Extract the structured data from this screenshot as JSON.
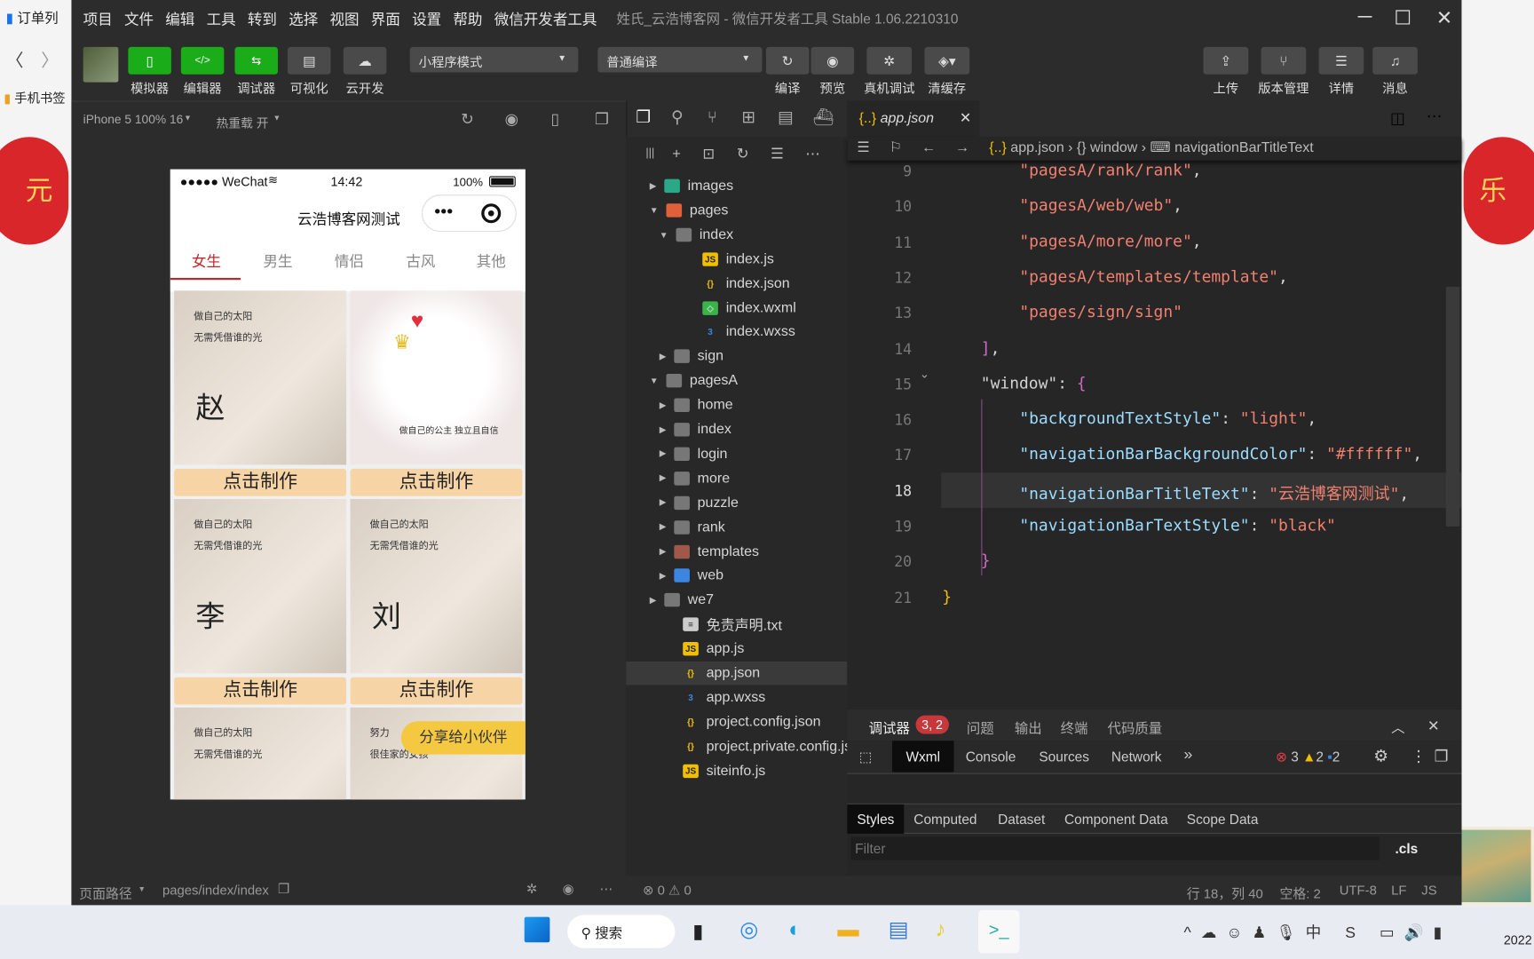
{
  "desktop": {
    "left_tab": "订单列",
    "left_bookmark": "手机书签",
    "right_lantern_left": "元",
    "right_lantern_right": "乐",
    "clock_year": "2022"
  },
  "window": {
    "menu": [
      "项目",
      "文件",
      "编辑",
      "工具",
      "转到",
      "选择",
      "视图",
      "界面",
      "设置",
      "帮助",
      "微信开发者工具"
    ],
    "title": "姓氏_云浩博客网 - 微信开发者工具 Stable 1.06.2210310",
    "toolbar_left": [
      {
        "label": "模拟器",
        "icon": "phone-icon",
        "active": true
      },
      {
        "label": "编辑器",
        "icon": "code-icon",
        "active": true
      },
      {
        "label": "调试器",
        "icon": "debug-icon",
        "active": true
      },
      {
        "label": "可视化",
        "icon": "layout-icon",
        "active": false
      },
      {
        "label": "云开发",
        "icon": "cloud-icon",
        "active": false
      }
    ],
    "mode_select": "小程序模式",
    "compile_select": "普通编译",
    "toolbar_mid": [
      {
        "label": "编译",
        "icon": "refresh-icon"
      },
      {
        "label": "预览",
        "icon": "eye-icon"
      },
      {
        "label": "真机调试",
        "icon": "bug-icon"
      },
      {
        "label": "清缓存",
        "icon": "layers-icon"
      }
    ],
    "toolbar_right": [
      {
        "label": "上传",
        "icon": "upload-icon"
      },
      {
        "label": "版本管理",
        "icon": "branch-icon"
      },
      {
        "label": "详情",
        "icon": "menu-icon"
      },
      {
        "label": "消息",
        "icon": "bell-icon"
      }
    ]
  },
  "simulator": {
    "device": "iPhone 5 100% 16",
    "hot_reload": "热重载 开",
    "phone": {
      "carrier": "●●●●● WeChat",
      "time": "14:42",
      "battery": "100%",
      "nav_title": "云浩博客网测试",
      "tabs": [
        "女生",
        "男生",
        "情侣",
        "古风",
        "其他"
      ],
      "active_tab": 0,
      "cards": [
        {
          "char": "赵",
          "line1": "做自己的太阳",
          "line2": "无需凭借谁的光",
          "button": "点击制作"
        },
        {
          "char": "",
          "line1": "",
          "line2": "做自己的公主 独立且自信",
          "button": "点击制作"
        },
        {
          "char": "李",
          "line1": "做自己的太阳",
          "line2": "无需凭借谁的光",
          "button": "点击制作"
        },
        {
          "char": "刘",
          "line1": "做自己的太阳",
          "line2": "无需凭借谁的光",
          "button": "点击制作"
        },
        {
          "char": "",
          "line1": "做自己的太阳",
          "line2": "无需凭借谁的光",
          "button": ""
        },
        {
          "char": "",
          "line1": "努力",
          "line2": "很佳家的女孩",
          "button": ""
        }
      ],
      "share_button": "分享给小伙伴"
    }
  },
  "filetree": [
    {
      "name": "images",
      "depth": 0,
      "type": "folder-img",
      "expanded": false
    },
    {
      "name": "pages",
      "depth": 0,
      "type": "folder-pages",
      "expanded": true
    },
    {
      "name": "index",
      "depth": 1,
      "type": "folder",
      "expanded": true
    },
    {
      "name": "index.js",
      "depth": 2,
      "type": "js"
    },
    {
      "name": "index.json",
      "depth": 2,
      "type": "json"
    },
    {
      "name": "index.wxml",
      "depth": 2,
      "type": "wxml"
    },
    {
      "name": "index.wxss",
      "depth": 2,
      "type": "wxss"
    },
    {
      "name": "sign",
      "depth": 1,
      "type": "folder",
      "expanded": false
    },
    {
      "name": "pagesA",
      "depth": 0,
      "type": "folder",
      "expanded": true
    },
    {
      "name": "home",
      "depth": 1,
      "type": "folder",
      "expanded": false
    },
    {
      "name": "index",
      "depth": 1,
      "type": "folder",
      "expanded": false
    },
    {
      "name": "login",
      "depth": 1,
      "type": "folder",
      "expanded": false
    },
    {
      "name": "more",
      "depth": 1,
      "type": "folder",
      "expanded": false
    },
    {
      "name": "puzzle",
      "depth": 1,
      "type": "folder",
      "expanded": false
    },
    {
      "name": "rank",
      "depth": 1,
      "type": "folder",
      "expanded": false
    },
    {
      "name": "templates",
      "depth": 1,
      "type": "folder-tpl",
      "expanded": false
    },
    {
      "name": "web",
      "depth": 1,
      "type": "folder-web",
      "expanded": false
    },
    {
      "name": "we7",
      "depth": 0,
      "type": "folder",
      "expanded": false
    },
    {
      "name": "免责声明.txt",
      "depth": 0,
      "type": "txt"
    },
    {
      "name": "app.js",
      "depth": 0,
      "type": "js"
    },
    {
      "name": "app.json",
      "depth": 0,
      "type": "json",
      "selected": true
    },
    {
      "name": "app.wxss",
      "depth": 0,
      "type": "wxss"
    },
    {
      "name": "project.config.json",
      "depth": 0,
      "type": "json"
    },
    {
      "name": "project.private.config.js...",
      "depth": 0,
      "type": "json"
    },
    {
      "name": "siteinfo.js",
      "depth": 0,
      "type": "js"
    }
  ],
  "editor": {
    "tab": "app.json",
    "breadcrumb": [
      "app.json",
      "window",
      "navigationBarTitleText"
    ],
    "current_line": 18,
    "lines": [
      {
        "n": "9",
        "indent": 2,
        "parts": [
          [
            "s",
            "\"pagesA/rank/rank\""
          ],
          [
            "p",
            ","
          ]
        ]
      },
      {
        "n": "10",
        "indent": 2,
        "parts": [
          [
            "s",
            "\"pagesA/web/web\""
          ],
          [
            "p",
            ","
          ]
        ]
      },
      {
        "n": "11",
        "indent": 2,
        "parts": [
          [
            "s",
            "\"pagesA/more/more\""
          ],
          [
            "p",
            ","
          ]
        ]
      },
      {
        "n": "12",
        "indent": 2,
        "parts": [
          [
            "s",
            "\"pagesA/templates/template\""
          ],
          [
            "p",
            ","
          ]
        ]
      },
      {
        "n": "13",
        "indent": 2,
        "parts": [
          [
            "s",
            "\"pages/sign/sign\""
          ]
        ]
      },
      {
        "n": "14",
        "indent": 1,
        "parts": [
          [
            "b",
            "]"
          ],
          [
            "p",
            ","
          ]
        ]
      },
      {
        "n": "15",
        "indent": 1,
        "parts": [
          [
            "p",
            "\"window\": "
          ],
          [
            "b",
            "{"
          ]
        ]
      },
      {
        "n": "16",
        "indent": 2,
        "parts": [
          [
            "k",
            "\"backgroundTextStyle\""
          ],
          [
            "p",
            ": "
          ],
          [
            "s",
            "\"light\""
          ],
          [
            "p",
            ","
          ]
        ]
      },
      {
        "n": "17",
        "indent": 2,
        "parts": [
          [
            "k",
            "\"navigationBarBackgroundColor\""
          ],
          [
            "p",
            ": "
          ],
          [
            "s",
            "\"#ffffff\""
          ],
          [
            "p",
            ","
          ]
        ]
      },
      {
        "n": "18",
        "indent": 2,
        "parts": [
          [
            "k",
            "\"navigationBarTitleText\""
          ],
          [
            "p",
            ": "
          ],
          [
            "s",
            "\"云浩博客网测试\""
          ],
          [
            "p",
            ","
          ]
        ]
      },
      {
        "n": "19",
        "indent": 2,
        "parts": [
          [
            "k",
            "\"navigationBarTextStyle\""
          ],
          [
            "p",
            ": "
          ],
          [
            "s",
            "\"black\""
          ]
        ]
      },
      {
        "n": "20",
        "indent": 1,
        "parts": [
          [
            "b",
            "}"
          ]
        ]
      },
      {
        "n": "21",
        "indent": 0,
        "parts": [
          [
            "y",
            "}"
          ]
        ]
      }
    ]
  },
  "devtools": {
    "tabs": [
      "调试器",
      "问题",
      "输出",
      "终端",
      "代码质量"
    ],
    "badge": "3, 2",
    "inner_tabs": [
      "Wxml",
      "Console",
      "Sources",
      "Network"
    ],
    "more": "»",
    "errors": "3",
    "warnings": "2",
    "infos": "2",
    "style_tabs": [
      "Styles",
      "Computed",
      "Dataset",
      "Component Data",
      "Scope Data"
    ],
    "filter_placeholder": "Filter",
    "cls": ".cls"
  },
  "statusbar": {
    "page_path_label": "页面路径",
    "page_path": "pages/index/index",
    "problems": "⊗ 0 ⚠ 0",
    "position": "行 18，列 40",
    "spaces": "空格: 2",
    "encoding": "UTF-8",
    "eol": "LF",
    "lang": "JS"
  },
  "taskbar": {
    "search": "搜索"
  },
  "colors": {
    "accent_green": "#1aad19",
    "tab_red": "#c0272d",
    "card_button": "#f7d4a5",
    "share_button": "#f5c842"
  }
}
